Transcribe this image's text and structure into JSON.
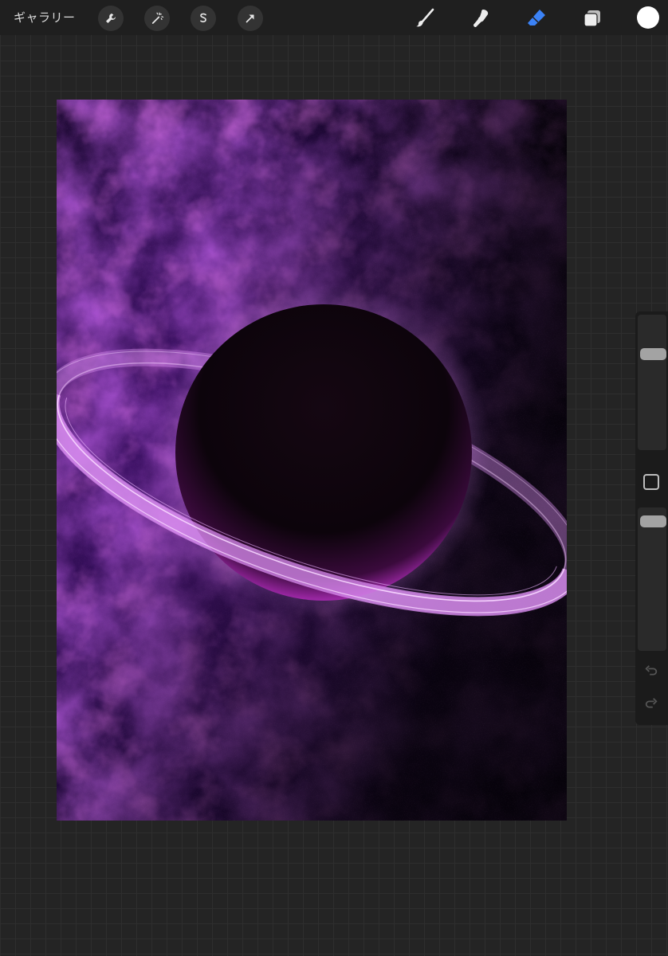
{
  "topbar": {
    "gallery_label": "ギャラリー",
    "left_tools": [
      "wrench-icon",
      "magic-wand-icon",
      "selection-s-icon",
      "transform-arrow-icon"
    ],
    "right_tools": [
      "brush-icon",
      "smudge-icon",
      "eraser-icon",
      "layers-icon"
    ],
    "active_tool": "eraser",
    "active_color": "#ffffff",
    "accent_color": "#3b82f6"
  },
  "canvas": {
    "artwork": "space-planet-with-ring",
    "colors": {
      "nebula_purple": "#7a1fb8",
      "nebula_magenta": "#d13be8",
      "nebula_blue": "#3a1f8f",
      "planet": "#0b0308",
      "ring": "#d98ef0"
    }
  },
  "sidebar": {
    "brush_size": 0.3,
    "opacity": 0.05
  }
}
